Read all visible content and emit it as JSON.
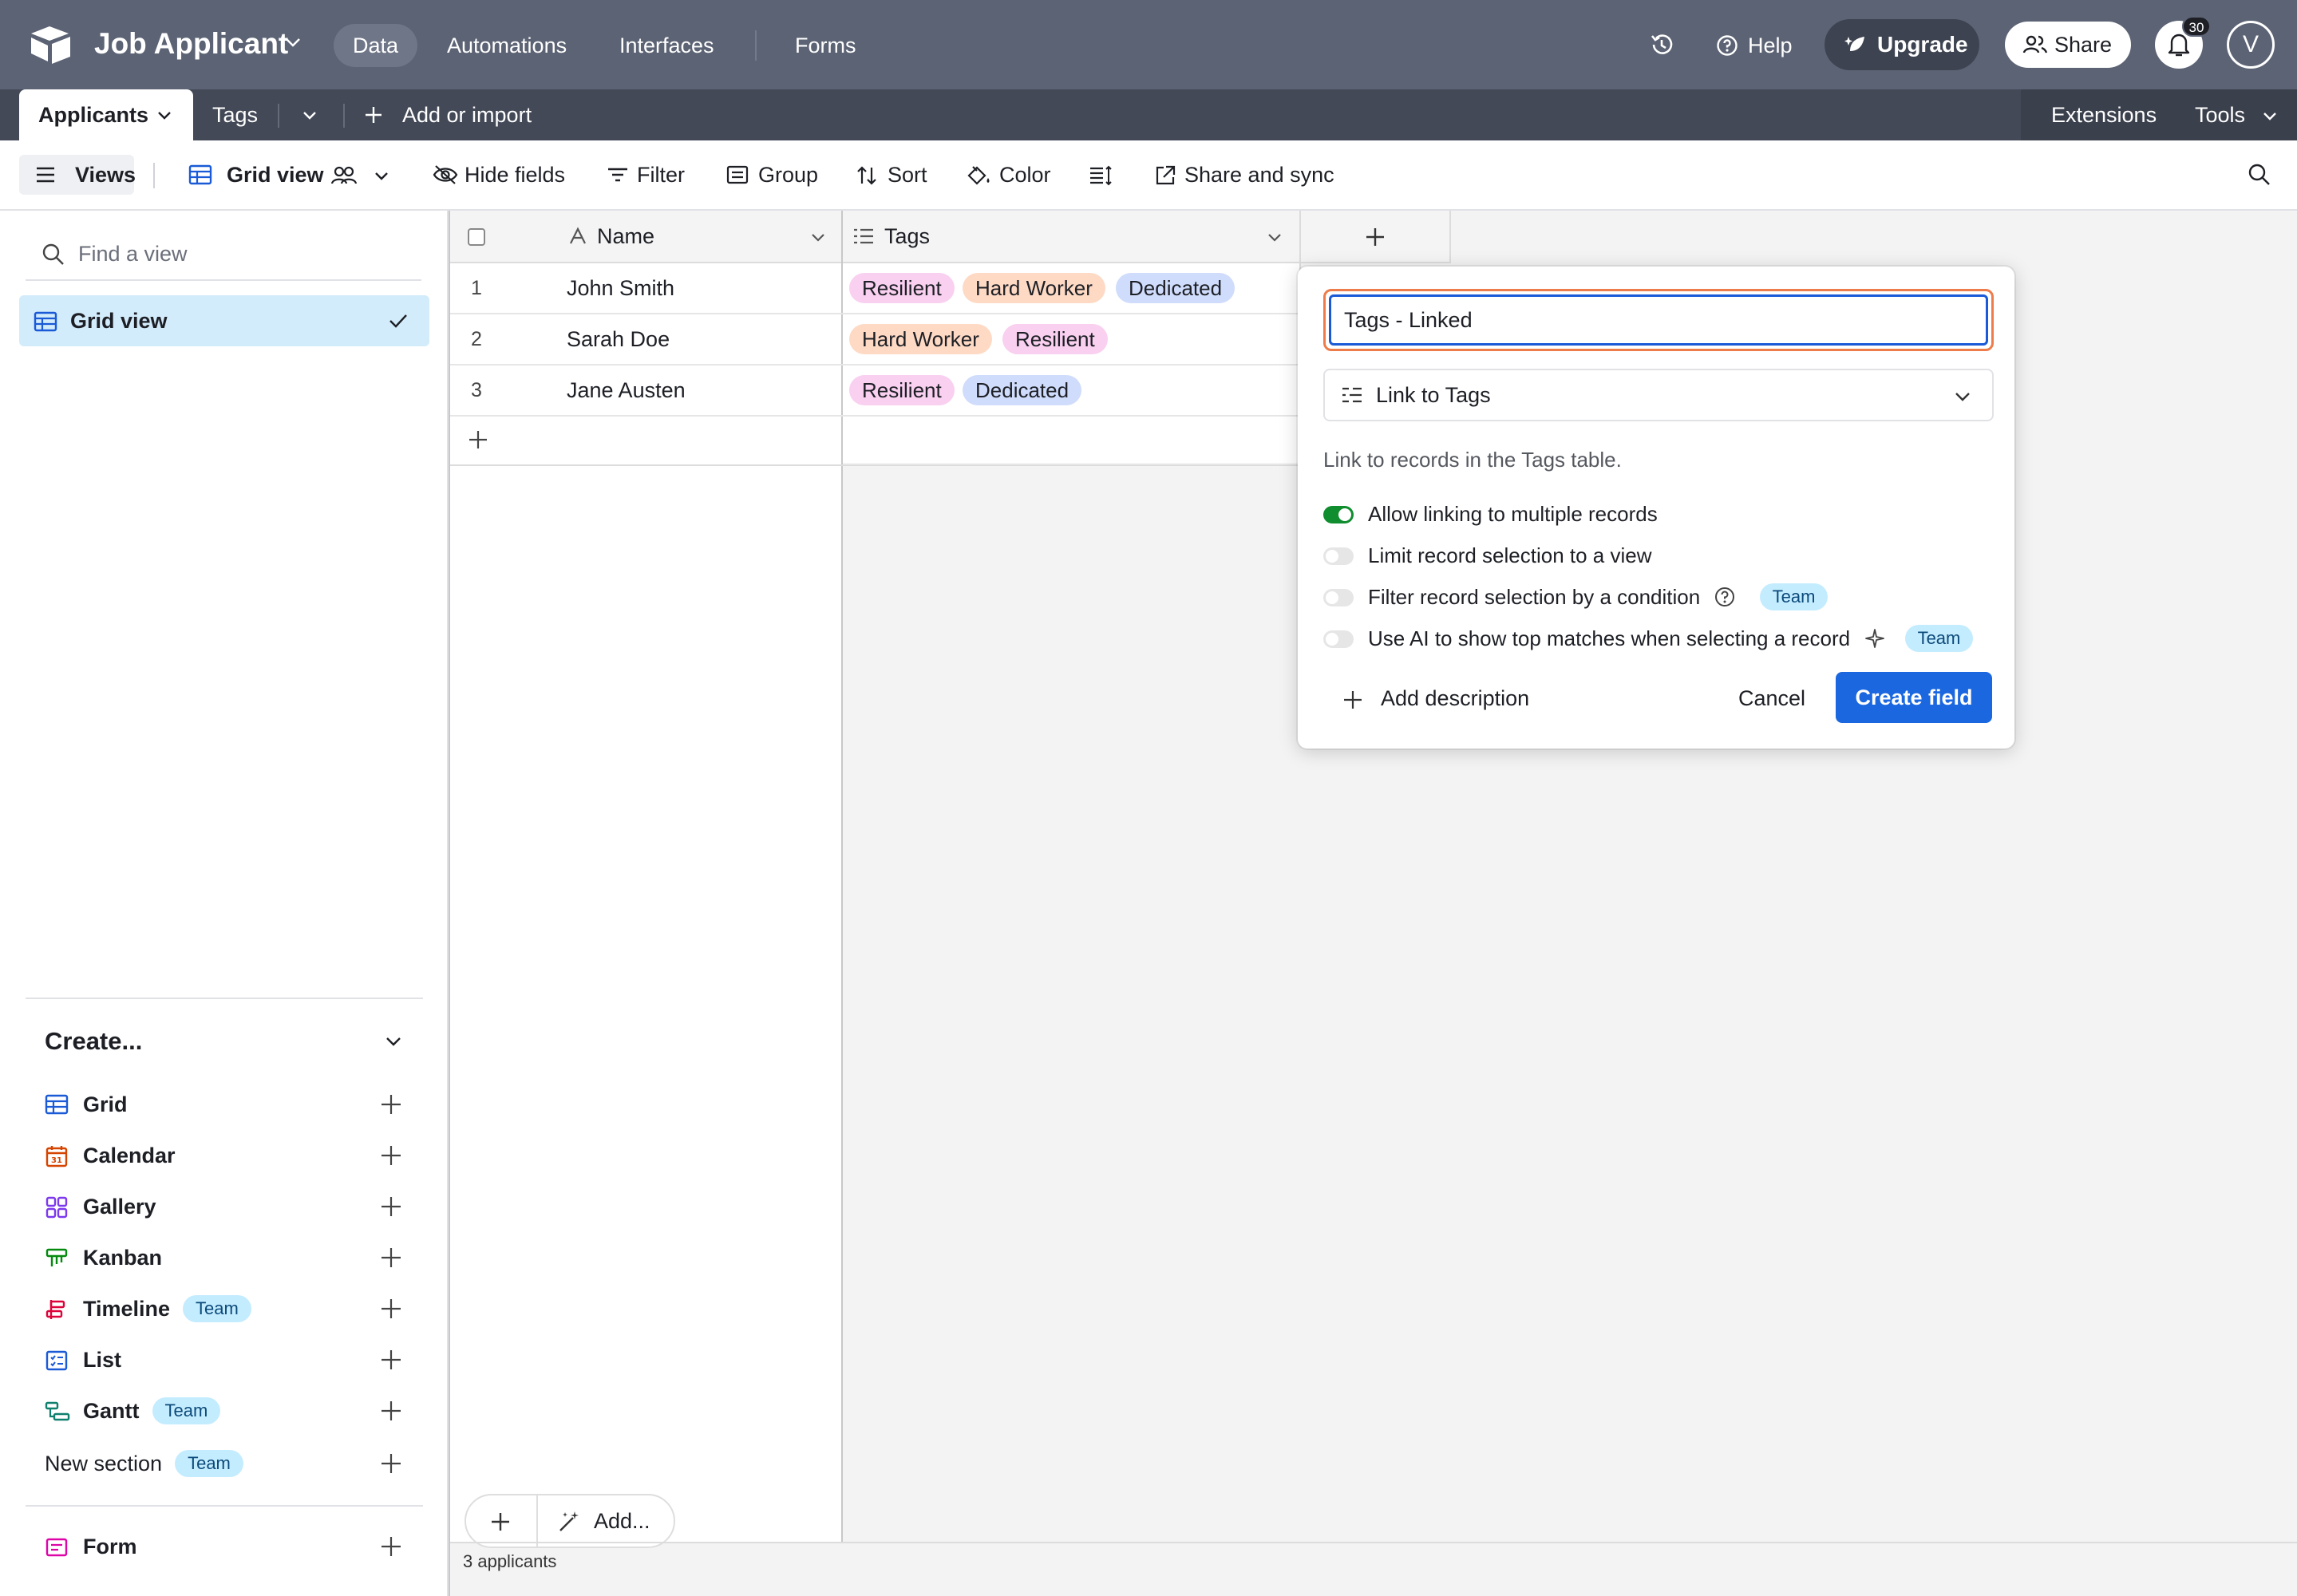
{
  "topbar": {
    "base_name": "Job Applicant",
    "nav": [
      "Data",
      "Automations",
      "Interfaces",
      "Forms"
    ],
    "help": "Help",
    "upgrade": "Upgrade",
    "share": "Share",
    "notifications_count": "30",
    "avatar_initial": "V"
  },
  "tabs": {
    "active": "Applicants",
    "other": "Tags",
    "add": "Add or import",
    "extensions": "Extensions",
    "tools": "Tools"
  },
  "toolbar": {
    "views": "Views",
    "view_name": "Grid view",
    "hide_fields": "Hide fields",
    "filter": "Filter",
    "group": "Group",
    "sort": "Sort",
    "color": "Color",
    "share_sync": "Share and sync"
  },
  "sidebar": {
    "find_placeholder": "Find a view",
    "current_view": "Grid view",
    "create_title": "Create...",
    "create_items": [
      {
        "label": "Grid",
        "badge": ""
      },
      {
        "label": "Calendar",
        "badge": ""
      },
      {
        "label": "Gallery",
        "badge": ""
      },
      {
        "label": "Kanban",
        "badge": ""
      },
      {
        "label": "Timeline",
        "badge": "Team"
      },
      {
        "label": "List",
        "badge": ""
      },
      {
        "label": "Gantt",
        "badge": "Team"
      },
      {
        "label": "New section",
        "badge": "Team"
      },
      {
        "label": "Form",
        "badge": ""
      }
    ]
  },
  "grid": {
    "columns": [
      "Name",
      "Tags"
    ],
    "rows": [
      {
        "num": "1",
        "name": "John Smith",
        "tags": [
          "Resilient",
          "Hard Worker",
          "Dedicated"
        ]
      },
      {
        "num": "2",
        "name": "Sarah Doe",
        "tags": [
          "Hard Worker",
          "Resilient"
        ]
      },
      {
        "num": "3",
        "name": "Jane Austen",
        "tags": [
          "Resilient",
          "Dedicated"
        ]
      }
    ],
    "add_label": "Add...",
    "record_count": "3 applicants"
  },
  "popup": {
    "field_name": "Tags - Linked",
    "field_type": "Link to Tags",
    "description": "Link to records in the Tags table.",
    "options": [
      {
        "label": "Allow linking to multiple records",
        "on": true,
        "badge": ""
      },
      {
        "label": "Limit record selection to a view",
        "on": false,
        "badge": ""
      },
      {
        "label": "Filter record selection by a condition",
        "on": false,
        "badge": "Team"
      },
      {
        "label": "Use AI to show top matches when selecting a record",
        "on": false,
        "badge": "Team"
      }
    ],
    "add_description": "Add description",
    "cancel": "Cancel",
    "create": "Create field"
  },
  "colors": {
    "topbar": "#5c6374",
    "tabbar": "#434957",
    "primary_button": "#1a67e0",
    "toggle_on": "#108d2e",
    "tag_resilient": "#f9d0f0",
    "tag_hard_worker": "#fedac5",
    "tag_dedicated": "#cfdcfb"
  }
}
